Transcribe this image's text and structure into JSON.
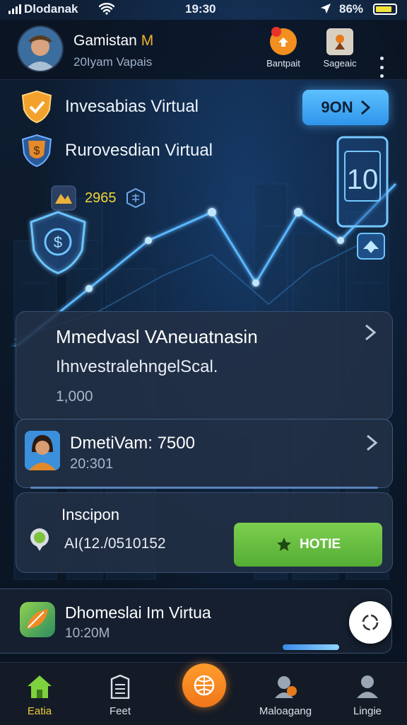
{
  "status_bar": {
    "carrier": "Dlodanak",
    "time": "19:30",
    "battery": "86%"
  },
  "header": {
    "user_name_main": "Gamistan",
    "user_name_suffix": "M",
    "user_subtitle": "20Iyam Vapais",
    "actions": [
      {
        "label": "Bantpait",
        "icon": "bell-badge-icon"
      },
      {
        "label": "Sageaic",
        "icon": "gift-box-icon"
      }
    ]
  },
  "hero": {
    "line1": "Invesabias Virtual",
    "line2": "Rurovesdian Virtual",
    "button_label": "9ON",
    "coins_value": "2965",
    "badge_number": "10"
  },
  "cards": {
    "summary": {
      "title": "Mmedvasl VAneuatnasin",
      "subtitle": "IhnvestralehngelScal.",
      "value": "1,000"
    },
    "person": {
      "name": "DmetiVam: 7500",
      "date": "20:301"
    },
    "inscipon": {
      "label": "Inscipon",
      "code": "AI(12./0510152",
      "button_label": "HOTIE"
    },
    "app_row": {
      "title": "Dhomeslai Im Virtua",
      "time": "10:20M",
      "progress": 0.5
    }
  },
  "tabbar": {
    "tabs": [
      {
        "label": "Eatia",
        "icon": "home-icon",
        "active": true
      },
      {
        "label": "Feet",
        "icon": "document-icon",
        "active": false
      },
      {
        "label": "Maloagang",
        "icon": "person-badge-icon",
        "active": false
      },
      {
        "label": "Lingie",
        "icon": "profile-icon",
        "active": false
      }
    ]
  },
  "colors": {
    "accent_blue": "#2f95ea",
    "accent_gold": "#f0b42c",
    "accent_green": "#55ad34",
    "accent_orange": "#f0761a",
    "background": "#0b1626"
  }
}
